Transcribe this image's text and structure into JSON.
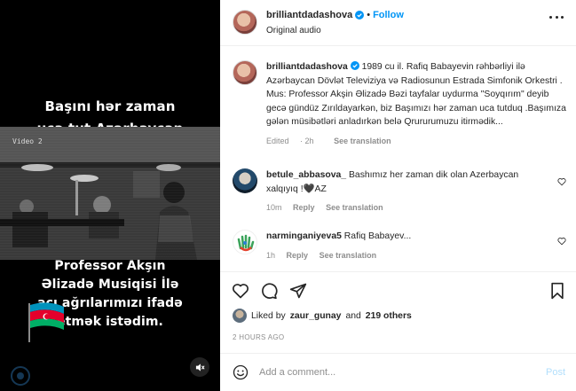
{
  "video": {
    "caption_top": "Başını hər zaman\nuca tut Azərbaycan",
    "caption_bottom": "Professor Akşın\nƏlizadə Musiqisi  İlə\nacı ağrılarımızı ifadə\netmək istədim.",
    "osd_text": "Video 2",
    "mute_icon": "speaker-muted-icon"
  },
  "header": {
    "username": "brilliantdadashova",
    "separator": "•",
    "follow_label": "Follow",
    "subtitle": "Original audio"
  },
  "caption": {
    "username": "brilliantdadashova",
    "text": "1989 cu il. Rafiq Babayevin rəhbərliyi ilə Azərbaycan Dövlət Televiziya və Radiosunun Estrada Simfonik Orkestri . Mus: Professor Akşin Əlizadə Bəzi tayfalar uydurma \"Soyqırım\" deyib gecə gündüz Zırıldayarkən, biz Başımızı hər zaman uca tutduq .Başımıza gələn müsibətləri anladırkən belə Qrururumuzu itirmədik...",
    "edited": "Edited",
    "time": "2h",
    "see_translation": "See translation"
  },
  "comments": [
    {
      "username": "betule_abbasova_",
      "text": "Bashımız her zaman dik olan Azerbaycan xalqıyıq !🖤AZ",
      "time": "10m",
      "reply": "Reply",
      "see_translation": "See translation"
    },
    {
      "username": "narminganiyeva5",
      "text": "Rafiq Babayev...",
      "time": "1h",
      "reply": "Reply",
      "see_translation": "See translation"
    }
  ],
  "likes": {
    "prefix": "Liked by",
    "user": "zaur_gunay",
    "and": "and",
    "others": "219 others"
  },
  "timestamp": "2 HOURS AGO",
  "add_comment": {
    "placeholder": "Add a comment...",
    "post_label": "Post"
  },
  "colors": {
    "accent": "#0095f6",
    "post_disabled": "#b2dffc",
    "muted_text": "#8e8e8e"
  }
}
